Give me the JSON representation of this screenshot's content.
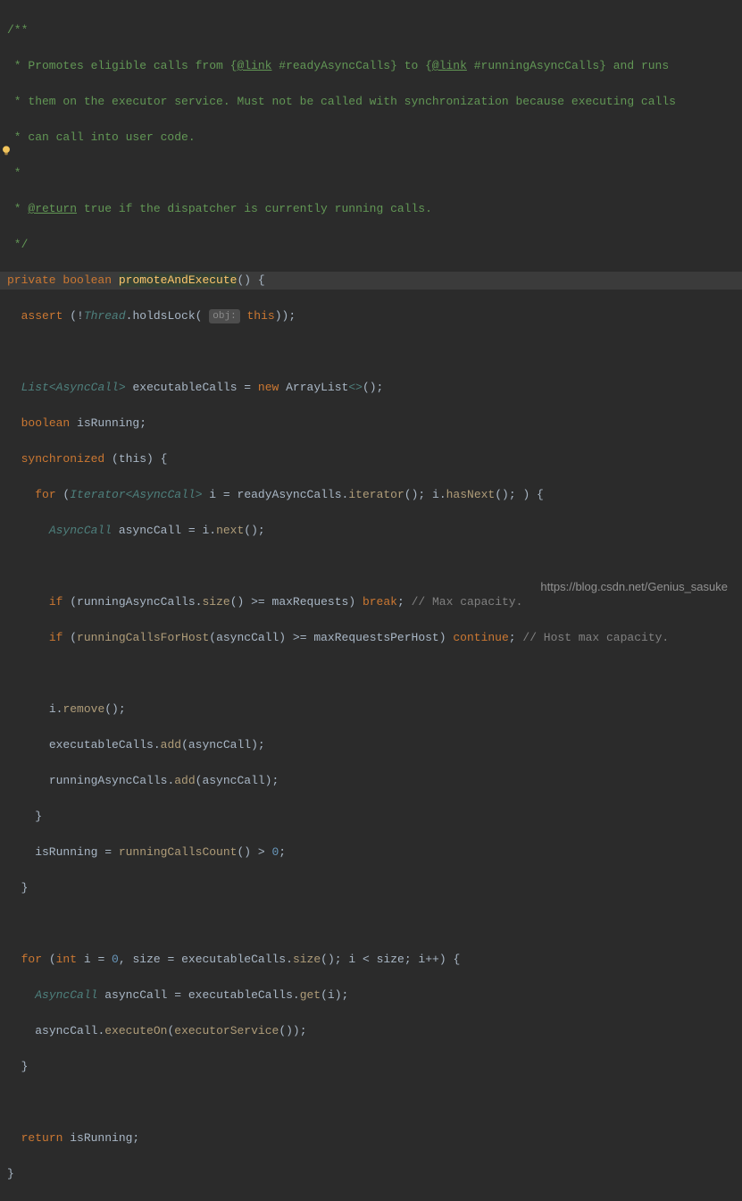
{
  "watermark": "https://blog.csdn.net/Genius_sasuke",
  "doc": {
    "c0": "/**",
    "c1": " * Promotes eligible calls from {",
    "c1a": "@link",
    "c1b": " #readyAsyncCalls} to {",
    "c1c": "@link",
    "c1d": " #runningAsyncCalls} and runs",
    "c2": " * them on the executor service. Must not be called with synchronization because executing calls",
    "c3": " * can call into user code.",
    "c4": " *",
    "c5": " * ",
    "c5a": "@return",
    "c5b": " true if the dispatcher is currently running calls.",
    "c6": " */"
  },
  "code": {
    "l7": {
      "private": "private",
      "boolean": "boolean",
      "name": "promoteAndExecute",
      "paren": "()",
      "brace": " {"
    },
    "l8": {
      "assert": "assert",
      "neg": " (!",
      "thread": "Thread",
      "dot": ".",
      "holds": "holdsLock",
      "op": "( ",
      "hint": "obj:",
      "this": "this",
      "close": "));"
    },
    "l9": "",
    "l10": {
      "list": "List",
      "lt": "<",
      "ac": "AsyncCall",
      "gt": ">",
      "var": " executableCalls",
      "eq": " = ",
      "new": "new",
      "al": " ArrayList",
      "diamond": "<>",
      "end": "();"
    },
    "l11": {
      "boolean": "boolean",
      "var": " isRunning;"
    },
    "l12": {
      "sync": "synchronized",
      "this": " (this) {"
    },
    "l13": {
      "for": "for",
      "open": " (",
      "iter": "Iterator",
      "lt": "<",
      "ac": "AsyncCall",
      "gt": ">",
      "i": " i",
      "eq": " = ",
      "ready": "readyAsyncCalls",
      "dot": ".",
      "call": "iterator",
      "p": "(); ",
      "i2": "i",
      "dot2": ".",
      "hn": "hasNext",
      "p2": "(); ) {"
    },
    "l14": {
      "ac": "AsyncCall",
      "var": " asyncCall",
      "eq": " = ",
      "i": "i",
      "dot": ".",
      "next": "next",
      "end": "();"
    },
    "l15": "",
    "l16": {
      "if": "if",
      "open": " (",
      "rac": "runningAsyncCalls",
      "dot": ".",
      "size": "size",
      "p": "()",
      "ge": " >= ",
      "mr": "maxRequests",
      "close": ") ",
      "break": "break",
      "sc": ";",
      "cmt": " // Max capacity."
    },
    "l17": {
      "if": "if",
      "open": " (",
      "rcfh": "runningCallsForHost",
      "p1": "(asyncCall)",
      "ge": " >= ",
      "mrph": "maxRequestsPerHost",
      "close": ") ",
      "cont": "continue",
      "sc": ";",
      "cmt": " // Host max capacity."
    },
    "l18": "",
    "l19": {
      "i": "i",
      "dot": ".",
      "rm": "remove",
      "end": "();"
    },
    "l20": {
      "ec": "executableCalls",
      "dot": ".",
      "add": "add",
      "arg": "(asyncCall);"
    },
    "l21": {
      "rac": "runningAsyncCalls",
      "dot": ".",
      "add": "add",
      "arg": "(asyncCall);"
    },
    "l22": "    }",
    "l23": {
      "ir": "    isRunning",
      "eq": " = ",
      "rcc": "runningCallsCount",
      "p": "()",
      "gt": " > ",
      "zero": "0",
      "sc": ";"
    },
    "l24": "  }",
    "l25": "",
    "l26": {
      "for": "for",
      "open": " (",
      "int": "int",
      "i": " i",
      "eq": " = ",
      "zero": "0",
      "comma": ", ",
      "size": "size",
      "eq2": " = ",
      "ec": "executableCalls",
      "dot": ".",
      "sz": "size",
      "p": "(); ",
      "i2": "i",
      "lt": " < ",
      "size2": "size",
      "sc": "; ",
      "i3": "i",
      "pp": "++",
      "end": ") {"
    },
    "l27": {
      "ac": "AsyncCall",
      "var": " asyncCall",
      "eq": " = ",
      "ec": "executableCalls",
      "dot": ".",
      "get": "get",
      "arg": "(i);"
    },
    "l28": {
      "ac": "asyncCall",
      "dot": ".",
      "eo": "executeOn",
      "open": "(",
      "es": "executorService",
      "p": "()",
      "end": ");"
    },
    "l29": "  }",
    "l30": "",
    "l31": {
      "ret": "return",
      "ir": " isRunning;"
    },
    "l32": "}"
  }
}
